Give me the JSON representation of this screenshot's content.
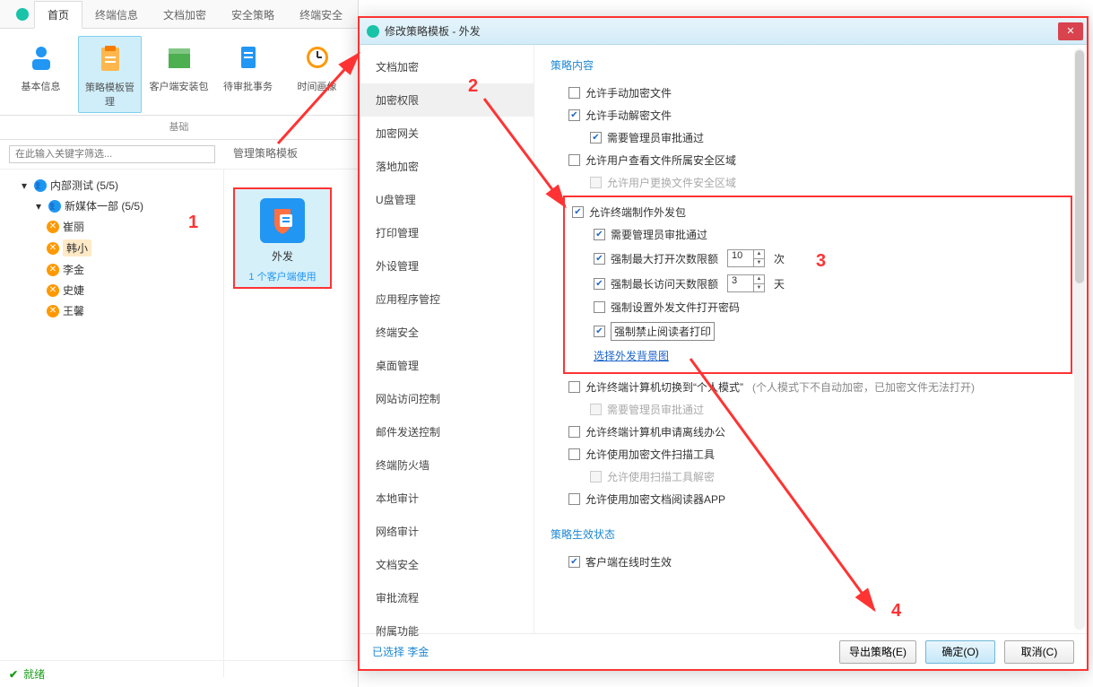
{
  "tabs": {
    "home": "首页",
    "terminal_info": "终端信息",
    "doc_enc": "文档加密",
    "sec_policy": "安全策略",
    "term_sec": "终端安全"
  },
  "ribbon": {
    "basic": "基本信息",
    "policy_tpl": "策略模板管理",
    "client_pkg": "客户端安装包",
    "pending": "待审批事务",
    "time_img": "时间画像",
    "group": "基础"
  },
  "search_placeholder": "在此输入关键字筛选...",
  "tree": {
    "root": "内部测试 (5/5)",
    "group": "新媒体一部 (5/5)",
    "users": [
      "崔丽",
      "韩小",
      "李金",
      "史婕",
      "王馨"
    ]
  },
  "template_panel": {
    "header": "管理策略模板",
    "card_title": "外发",
    "card_sub": "1 个客户端使用"
  },
  "status": "就绪",
  "dialog": {
    "title": "修改策略模板 - 外发",
    "nav": [
      "文档加密",
      "加密权限",
      "加密网关",
      "落地加密",
      "U盘管理",
      "打印管理",
      "外设管理",
      "应用程序管控",
      "终端安全",
      "桌面管理",
      "网站访问控制",
      "邮件发送控制",
      "终端防火墙",
      "本地审计",
      "网络审计",
      "文档安全",
      "审批流程",
      "附属功能"
    ],
    "section1": "策略内容",
    "c_manual_enc": "允许手动加密文件",
    "c_manual_dec": "允许手动解密文件",
    "c_need_admin": "需要管理员审批通过",
    "c_view_area": "允许用户查看文件所属安全区域",
    "c_change_area": "允许用户更换文件安全区域",
    "c_make_pkg": "允许终端制作外发包",
    "c_need_admin2": "需要管理员审批通过",
    "c_max_open": "强制最大打开次数限额",
    "c_max_open_val": "10",
    "c_max_open_unit": "次",
    "c_max_days": "强制最长访问天数限额",
    "c_max_days_val": "3",
    "c_max_days_unit": "天",
    "c_force_pwd": "强制设置外发文件打开密码",
    "c_forbid_print": "强制禁止阅读者打印",
    "link_bg": "选择外发背景图",
    "c_personal": "允许终端计算机切换到“个人模式”",
    "c_personal_note": "(个人模式下不自动加密，已加密文件无法打开)",
    "c_need_admin3": "需要管理员审批通过",
    "c_offline": "允许终端计算机申请离线办公",
    "c_scan": "允许使用加密文件扫描工具",
    "c_scan_dec": "允许使用扫描工具解密",
    "c_reader": "允许使用加密文档阅读器APP",
    "section2": "策略生效状态",
    "c_online": "客户端在线时生效",
    "footer_sel": "已选择 李金",
    "btn_export": "导出策略(E)",
    "btn_ok": "确定(O)",
    "btn_cancel": "取消(C)"
  },
  "anno": {
    "n1": "1",
    "n2": "2",
    "n3": "3",
    "n4": "4"
  }
}
